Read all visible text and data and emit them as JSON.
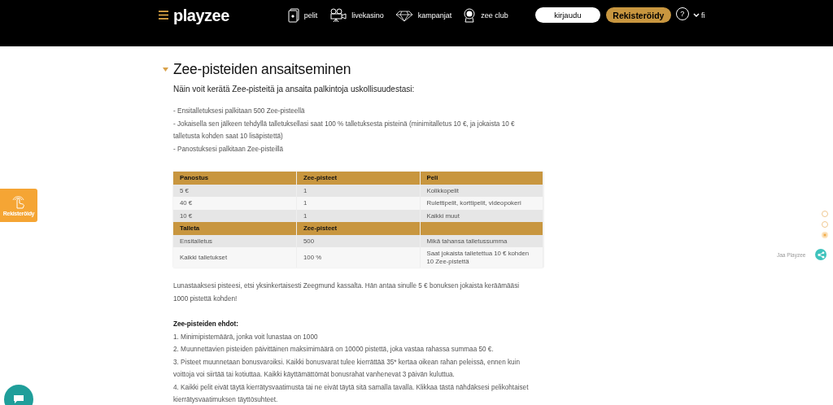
{
  "header": {
    "logo": "playzee",
    "nav": [
      {
        "label": "pelit",
        "kind": "cards"
      },
      {
        "label": "livekasino",
        "kind": "camera"
      },
      {
        "label": "kampanjat",
        "kind": "diamond"
      },
      {
        "label": "zee club",
        "kind": "badge"
      }
    ],
    "login": "kirjaudu",
    "register": "Rekisteröidy",
    "help": "?",
    "language": "fi"
  },
  "side_register": {
    "label": "Rekisteröidy"
  },
  "section": {
    "title": "Zee-pisteiden ansaitseminen",
    "expanded": true,
    "intro": "Näin voit kerätä Zee-pisteitä ja ansaita palkintoja uskollisuudestasi:",
    "bullets": [
      "- Ensitalletuksesi palkitaan 500 Zee-pisteellä",
      "- Jokaisella sen jälkeen tehdyllä talletuksellasi saat 100 % talletuksesta pisteinä (minimitalletus 10 €, ja jokaista 10 € talletusta kohden saat 10 lisäpistettä)",
      "- Panostuksesi palkitaan Zee-pisteillä"
    ],
    "table": [
      {
        "kind": "head",
        "cells": [
          "Panostus",
          "Zee-pisteet",
          "Peli"
        ]
      },
      {
        "kind": "row",
        "cells": [
          "5 €",
          "1",
          "Kolikkopelit"
        ]
      },
      {
        "kind": "row",
        "cells": [
          "40 €",
          "1",
          "Rulettipelit, korttipelit, videopokeri"
        ]
      },
      {
        "kind": "row",
        "cells": [
          "10 €",
          "1",
          "Kaikki muut"
        ]
      },
      {
        "kind": "head",
        "cells": [
          "Talleta",
          "Zee-pisteet",
          ""
        ]
      },
      {
        "kind": "row",
        "cells": [
          "Ensitalletus",
          "500",
          "Mikä tahansa talletussumma"
        ]
      },
      {
        "kind": "row",
        "cells": [
          "Kaikki talletukset",
          "100 %",
          "Saat jokaista talletettua 10 € kohden 10 Zee-pistettä"
        ]
      }
    ],
    "redeem": "Lunastaaksesi pisteesi, etsi yksinkertaisesti Zeegmund kassalta. Hän antaa sinulle 5 € bonuksen jokaista keräämääsi 1000 pistettä kohden!",
    "terms_title": "Zee-pisteiden ehdot:",
    "terms": [
      "1. Minimipistemäärä, jonka voit lunastaa on 1000",
      "2. Muunnettavien pisteiden päivittäinen maksimimäärä on 10000 pistettä, joka vastaa rahassa summaa 50 €.",
      "3. Pisteet muunnetaan bonusvaroiksi. Kaikki bonusvarat tulee kierrättää 35* kertaa oikean rahan peleissä, ennen kuin voittoja voi siirtää tai kotiuttaa. Kaikki käyttämättömät bonusrahat vanhenevat 3 päivän kuluttua.",
      "4. Kaikki pelit eivät täytä kierrätysvaatimusta tai ne eivät täytä sitä samalla tavalla. Klikkaa tästä nähdäksesi pelikohtaiset kierrätysvaatimuksen täyttösuhteet."
    ]
  },
  "page_dots": [
    {
      "selected": false
    },
    {
      "selected": false
    },
    {
      "selected": true
    }
  ],
  "share": {
    "label": "Jaa Playzee"
  }
}
